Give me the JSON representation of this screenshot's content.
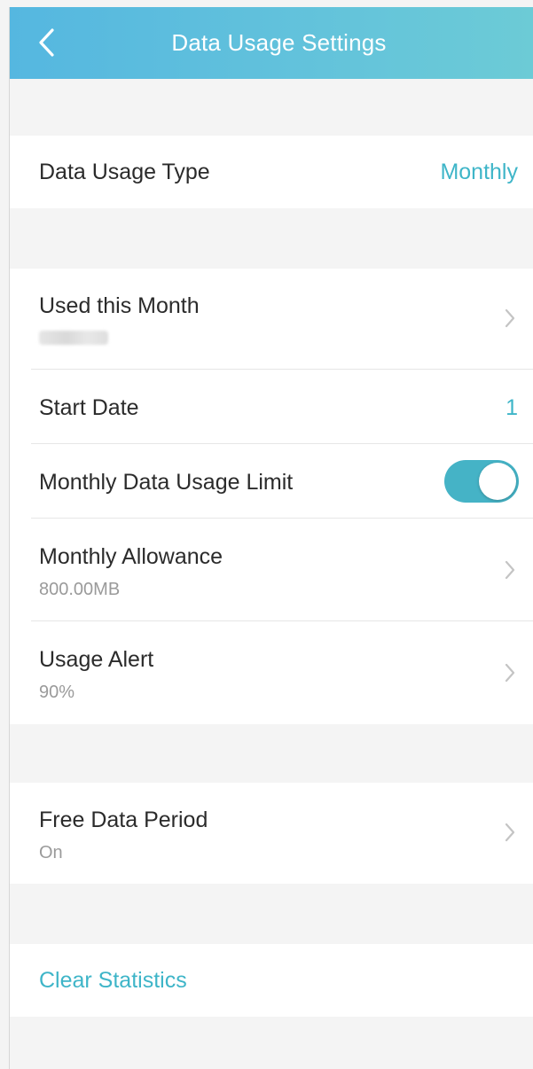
{
  "header": {
    "title": "Data Usage Settings"
  },
  "data_usage_type": {
    "label": "Data Usage Type",
    "value": "Monthly"
  },
  "used_this_month": {
    "label": "Used this Month"
  },
  "start_date": {
    "label": "Start Date",
    "value": "1"
  },
  "monthly_limit": {
    "label": "Monthly Data Usage Limit",
    "enabled": true
  },
  "monthly_allowance": {
    "label": "Monthly Allowance",
    "value": "800.00MB"
  },
  "usage_alert": {
    "label": "Usage Alert",
    "value": "90%"
  },
  "free_data_period": {
    "label": "Free Data Period",
    "value": "On"
  },
  "clear_statistics": {
    "label": "Clear Statistics"
  },
  "colors": {
    "accent": "#3eb5c8",
    "header_start": "#55b7e0",
    "header_end": "#6ccbd6",
    "background": "#f4f4f4"
  }
}
